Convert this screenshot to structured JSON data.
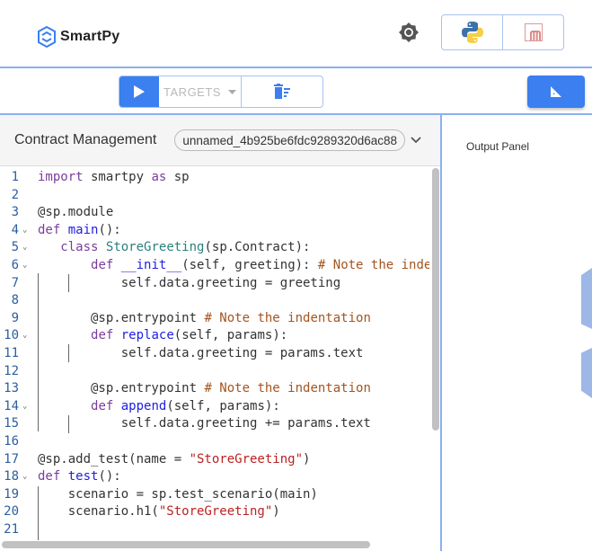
{
  "header": {
    "brand": "SmartPy",
    "theme_icon": "gear-icon",
    "languages": [
      {
        "name": "python-icon"
      },
      {
        "name": "michelson-icon"
      }
    ]
  },
  "toolbar": {
    "run_icon": "play-icon",
    "targets_label": "TARGETS",
    "clear_icon": "clear-output-icon",
    "ruler_icon": "ruler-icon"
  },
  "contract": {
    "title": "Contract Management",
    "selected": "unnamed_4b925be6fdc9289320d6ac88"
  },
  "output": {
    "title": "Output Panel"
  },
  "colors": {
    "accent": "#3b7ff0",
    "border": "#8ab0ef"
  },
  "editor": {
    "lines": [
      {
        "n": "1",
        "fold": false,
        "html": "<span class='kw'>import</span> smartpy <span class='kw'>as</span> sp"
      },
      {
        "n": "2",
        "fold": false,
        "html": ""
      },
      {
        "n": "3",
        "fold": false,
        "html": "@sp.module"
      },
      {
        "n": "4",
        "fold": true,
        "html": "<span class='kw'>def</span> <span class='fn'>main</span>():"
      },
      {
        "n": "5",
        "fold": true,
        "html": "   <span class='kw'>class</span> <span class='cl'>StoreGreeting</span>(sp.Contract):"
      },
      {
        "n": "6",
        "fold": true,
        "html": "       <span class='kw'>def</span> <span class='fn'>__init__</span>(self, greeting): <span class='cm2'># Note the indentation</span>"
      },
      {
        "n": "7",
        "fold": false,
        "html": "           self.data.greeting = greeting"
      },
      {
        "n": "8",
        "fold": false,
        "html": ""
      },
      {
        "n": "9",
        "fold": false,
        "html": "       @sp.entrypoint <span class='cm2'># Note the indentation</span>"
      },
      {
        "n": "10",
        "fold": true,
        "html": "       <span class='kw'>def</span> <span class='fn'>replace</span>(self, params):"
      },
      {
        "n": "11",
        "fold": false,
        "html": "           self.data.greeting = params.text"
      },
      {
        "n": "12",
        "fold": false,
        "html": ""
      },
      {
        "n": "13",
        "fold": false,
        "html": "       @sp.entrypoint <span class='cm2'># Note the indentation</span>"
      },
      {
        "n": "14",
        "fold": true,
        "html": "       <span class='kw'>def</span> <span class='fn'>append</span>(self, params):"
      },
      {
        "n": "15",
        "fold": false,
        "html": "           self.data.greeting += params.text"
      },
      {
        "n": "16",
        "fold": false,
        "html": ""
      },
      {
        "n": "17",
        "fold": false,
        "html": "@sp.add_test(name = <span class='st'>\"StoreGreeting\"</span>)"
      },
      {
        "n": "18",
        "fold": true,
        "html": "<span class='kw'>def</span> <span class='fn'>test</span>():"
      },
      {
        "n": "19",
        "fold": false,
        "html": "    scenario = sp.test_scenario(main)"
      },
      {
        "n": "20",
        "fold": false,
        "html": "    scenario.h1(<span class='st'>\"StoreGreeting\"</span>)"
      },
      {
        "n": "21",
        "fold": false,
        "html": ""
      }
    ]
  }
}
